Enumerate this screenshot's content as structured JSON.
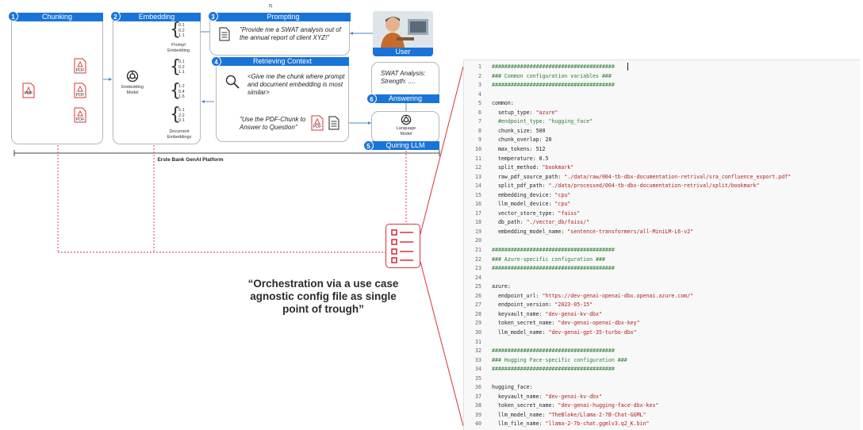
{
  "steps": {
    "chunking": {
      "num": "1",
      "title": "Chunking"
    },
    "embedding": {
      "num": "2",
      "title": "Embedding"
    },
    "prompting": {
      "num": "3",
      "title": "Prompting"
    },
    "retrieving": {
      "num": "4",
      "title": "Retrieving Context"
    },
    "quiring": {
      "num": "5",
      "title": "Quiring LLM"
    },
    "answering": {
      "num": "6",
      "title": "Answering"
    }
  },
  "chunking": {
    "pdf_label": "PDF"
  },
  "embedding": {
    "model_label": "Embedding Model",
    "prompt_vec": [
      "0.1",
      "0.2",
      "1.1"
    ],
    "prompt_label": "Prompt Embedding",
    "doc_vec1": [
      "0.1",
      "0.2",
      "1.1"
    ],
    "doc_vec2": [
      "1.2",
      "0.4",
      "1.6"
    ],
    "doc_vec3": [
      "5.1",
      "2.2",
      "0.1"
    ],
    "doc_label": "Document Embeddings"
  },
  "prompting": {
    "superscript": "3)",
    "text": "\"Provide me a SWAT analysis out of the annual report of client XYZ!\""
  },
  "user": {
    "label": "User"
  },
  "retrieving": {
    "text1": "<Give me the chunk where prompt and document embedding is most similar>",
    "text2": "\"Use the PDF-Chunk to Answer to Question\""
  },
  "answering": {
    "text": "SWAT Analysis: Strength: ...."
  },
  "llm": {
    "label": "Language Model"
  },
  "platform": {
    "label": "Erste Bank GenAI Platform"
  },
  "quote": "“Orchestration via a use case agnostic config file as single point of trough”",
  "colors": {
    "accent": "#1a74d8",
    "dashed": "#d8323c",
    "comment": "#2e7d32",
    "string": "#b02020"
  },
  "code_lines": [
    {
      "n": "1",
      "t": "#######################################",
      "type": "c"
    },
    {
      "n": "2",
      "t": "### Common configuration variables ###",
      "type": "c"
    },
    {
      "n": "3",
      "t": "#######################################",
      "type": "c"
    },
    {
      "n": "4",
      "t": "",
      "type": "k"
    },
    {
      "n": "5",
      "t": "common:",
      "type": "k"
    },
    {
      "n": "6",
      "t": "  setup_type: ",
      "s": "\"azure\"",
      "type": "k"
    },
    {
      "n": "7",
      "t": "  #endpoint_type: \"hugging_face\"",
      "type": "c"
    },
    {
      "n": "8",
      "t": "  chunk_size: 500",
      "type": "k"
    },
    {
      "n": "9",
      "t": "  chunk_overlap: 20",
      "type": "k"
    },
    {
      "n": "10",
      "t": "  max_tokens: 512",
      "type": "k"
    },
    {
      "n": "11",
      "t": "  temperature: 0.5",
      "type": "k"
    },
    {
      "n": "12",
      "t": "  split_method: ",
      "s": "\"bookmark\"",
      "type": "k"
    },
    {
      "n": "13",
      "t": "  raw_pdf_source_path: ",
      "s": "\"./data/raw/004-tb-dbx-documentation-retrival/sra_confluence_export.pdf\"",
      "type": "k"
    },
    {
      "n": "14",
      "t": "  split_pdf_path: ",
      "s": "\"./data/processed/004-tb-dbx-documentation-retrival/split/bookmark\"",
      "type": "k"
    },
    {
      "n": "15",
      "t": "  embedding_device: ",
      "s": "\"cpu\"",
      "type": "k"
    },
    {
      "n": "16",
      "t": "  llm_model_device: ",
      "s": "\"cpu\"",
      "type": "k"
    },
    {
      "n": "17",
      "t": "  vector_store_type: ",
      "s": "\"faiss\"",
      "type": "k"
    },
    {
      "n": "18",
      "t": "  db_path: ",
      "s": "\"./vector_db/faiss/\"",
      "type": "k"
    },
    {
      "n": "19",
      "t": "  embedding_model_name: ",
      "s": "\"sentence-transformers/all-MiniLM-L6-v2\"",
      "type": "k"
    },
    {
      "n": "20",
      "t": "",
      "type": "k"
    },
    {
      "n": "21",
      "t": "#######################################",
      "type": "c"
    },
    {
      "n": "22",
      "t": "### Azure-specific configuration ###",
      "type": "c"
    },
    {
      "n": "23",
      "t": "#######################################",
      "type": "c"
    },
    {
      "n": "24",
      "t": "",
      "type": "k"
    },
    {
      "n": "25",
      "t": "azure:",
      "type": "k"
    },
    {
      "n": "26",
      "t": "  endpoint_url: ",
      "s": "\"https://dev-genai-openai-dbx.openai.azure.com/\"",
      "type": "k"
    },
    {
      "n": "27",
      "t": "  endpoint_version: ",
      "s": "\"2023-05-15\"",
      "type": "k"
    },
    {
      "n": "28",
      "t": "  keyvault_name: ",
      "s": "\"dev-genai-kv-dbx\"",
      "type": "k"
    },
    {
      "n": "29",
      "t": "  token_secret_name: ",
      "s": "\"dev-genai-openai-dbx-key\"",
      "type": "k"
    },
    {
      "n": "30",
      "t": "  llm_model_name: ",
      "s": "\"dev-genai-gpt-35-turbo-dbx\"",
      "type": "k"
    },
    {
      "n": "31",
      "t": "",
      "type": "k"
    },
    {
      "n": "32",
      "t": "#######################################",
      "type": "c"
    },
    {
      "n": "33",
      "t": "### Hugging Face-specific configuration ###",
      "type": "c"
    },
    {
      "n": "34",
      "t": "#######################################",
      "type": "c"
    },
    {
      "n": "35",
      "t": "",
      "type": "k"
    },
    {
      "n": "36",
      "t": "hugging_face:",
      "type": "k"
    },
    {
      "n": "37",
      "t": "  keyvault_name: ",
      "s": "\"dev-genai-kv-dbx\"",
      "type": "k"
    },
    {
      "n": "38",
      "t": "  token_secret_name: ",
      "s": "\"dev-genai-hugging-face-dbx-kex\"",
      "type": "k"
    },
    {
      "n": "39",
      "t": "  llm_model_name: ",
      "s": "\"TheBloke/Llama-2-7B-Chat-GGML\"",
      "type": "k"
    },
    {
      "n": "40",
      "t": "  llm_file_name: ",
      "s": "\"llama-2-7b-chat.ggmlv3.q2_K.bin\"",
      "type": "k"
    }
  ]
}
